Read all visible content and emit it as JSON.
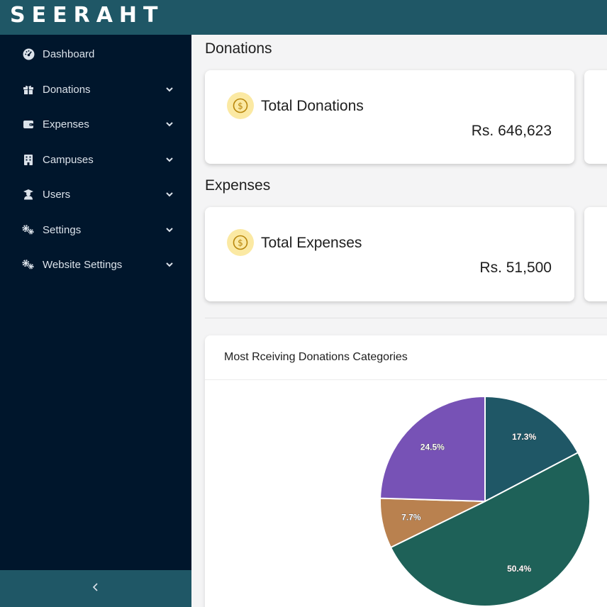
{
  "app": {
    "logo_text": "SEERAHT"
  },
  "sidebar": {
    "items": [
      {
        "label": "Dashboard",
        "icon": "gauge-icon",
        "has_chevron": false
      },
      {
        "label": "Donations",
        "icon": "gift-icon",
        "has_chevron": true
      },
      {
        "label": "Expenses",
        "icon": "wallet-icon",
        "has_chevron": true
      },
      {
        "label": "Campuses",
        "icon": "building-icon",
        "has_chevron": true
      },
      {
        "label": "Users",
        "icon": "graduate-icon",
        "has_chevron": true
      },
      {
        "label": "Settings",
        "icon": "gears-icon",
        "has_chevron": true
      },
      {
        "label": "Website Settings",
        "icon": "gears-icon",
        "has_chevron": true
      }
    ],
    "collapse_icon": "chevron-left-icon"
  },
  "donations": {
    "title": "Donations",
    "total_label": "Total Donations",
    "total_value": "Rs. 646,623"
  },
  "expenses": {
    "title": "Expenses",
    "total_label": "Total Expenses",
    "total_value": "Rs. 51,500"
  },
  "colors": {
    "topbar": "#1f5766",
    "sidebar": "#00162c",
    "stat_icon_bg": "#fbe9a3",
    "stat_icon_fg": "#b8860b"
  },
  "chart": {
    "title": "Most Rceiving Donations Categories"
  },
  "chart_data": {
    "type": "pie",
    "title": "Most Rceiving Donations Categories",
    "slices": [
      {
        "label": "17.3%",
        "value": 17.3,
        "color": "#1f5766"
      },
      {
        "label": "50.4%",
        "value": 50.4,
        "color": "#1e6158"
      },
      {
        "label": "7.7%",
        "value": 7.7,
        "color": "#b9814f"
      },
      {
        "label": "24.5%",
        "value": 24.5,
        "color": "#7752b6"
      }
    ]
  }
}
